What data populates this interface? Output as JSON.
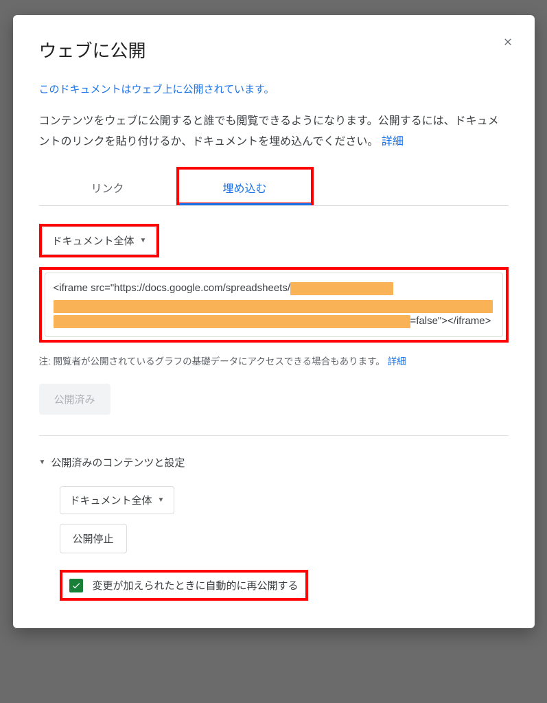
{
  "dialog": {
    "title": "ウェブに公開",
    "status": "このドキュメントはウェブ上に公開されています。",
    "description_prefix": "コンテンツをウェブに公開すると誰でも閲覧できるようになります。公開するには、ドキュメントのリンクを貼り付けるか、ドキュメントを埋め込んでください。",
    "learn_more": "詳細"
  },
  "tabs": {
    "link": "リンク",
    "embed": "埋め込む"
  },
  "scope_dropdown": {
    "selected": "ドキュメント全体"
  },
  "embed_code": {
    "prefix": "<iframe src=\"https://docs.google.com/spreadsheets/",
    "suffix": "=false\"></iframe>"
  },
  "note": {
    "prefix": "注: 閲覧者が公開されているグラフの基礎データにアクセスできる場合もあります。",
    "link": "詳細"
  },
  "published_button": "公開済み",
  "settings": {
    "header": "公開済みのコンテンツと設定",
    "scope_selected": "ドキュメント全体",
    "stop_button": "公開停止",
    "auto_republish": "変更が加えられたときに自動的に再公開する"
  }
}
